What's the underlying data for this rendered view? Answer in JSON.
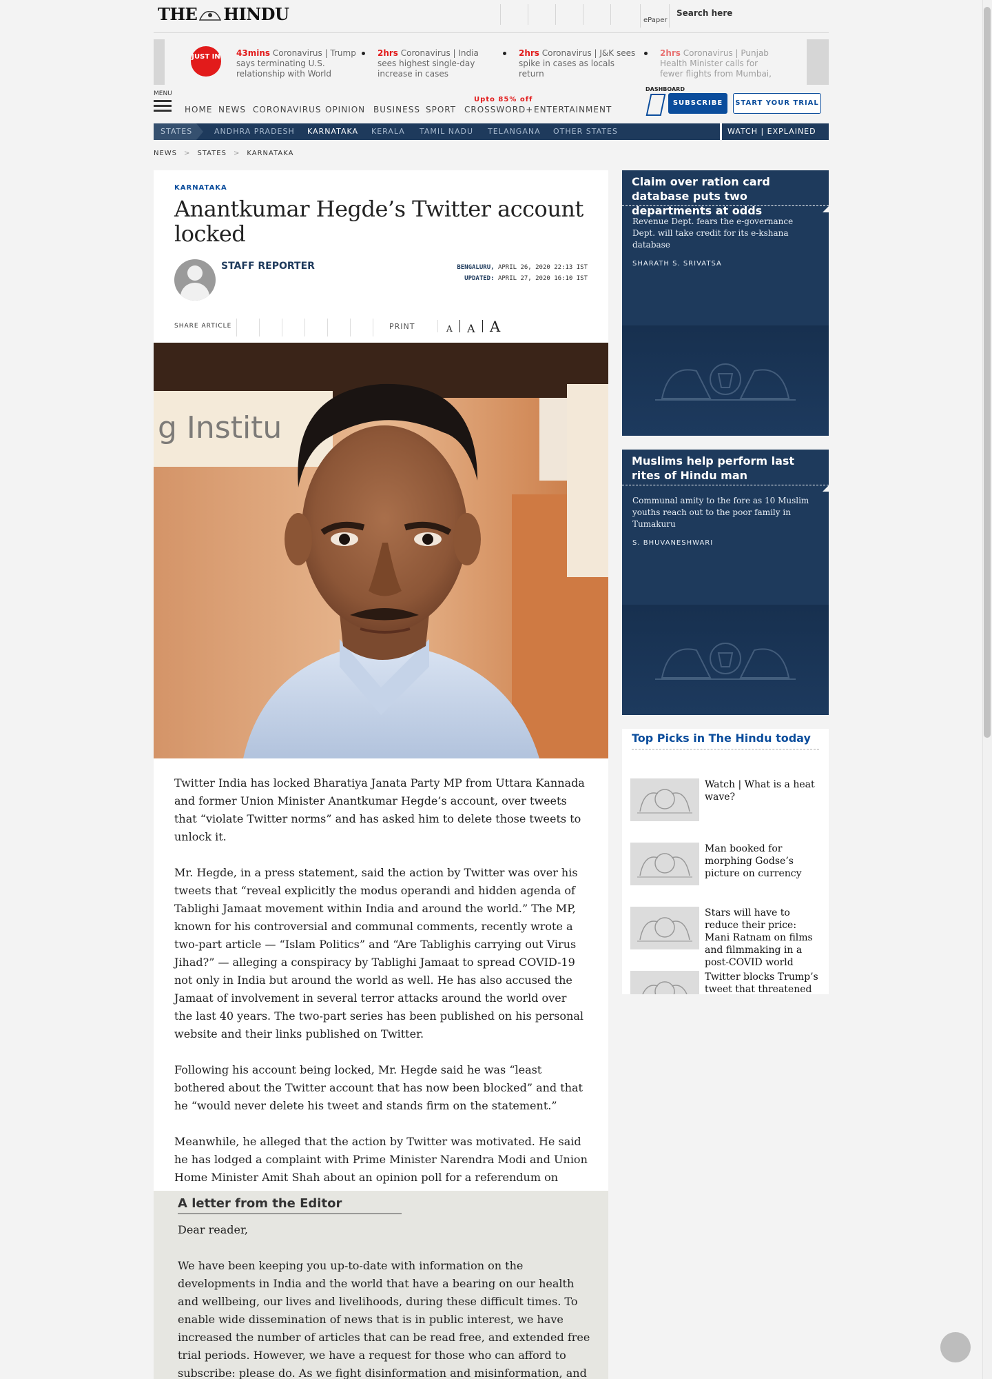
{
  "header": {
    "logo_left": "THE",
    "logo_right": "HINDU",
    "epaper_label": "ePaper",
    "search_label": "Search here"
  },
  "just_in": {
    "badge": "JUST IN",
    "items": [
      {
        "time": "43mins",
        "text": "Coronavirus | Trump says terminating U.S. relationship with World"
      },
      {
        "time": "2hrs",
        "text": "Coronavirus | India sees highest single-day increase in cases"
      },
      {
        "time": "2hrs",
        "text": "Coronavirus | J&K sees spike in cases as locals return"
      },
      {
        "time": "2hrs",
        "text": "Coronavirus | Punjab Health Minister calls for fewer flights from Mumbai,"
      }
    ]
  },
  "nav": {
    "menu_label": "MENU",
    "items": [
      "HOME",
      "NEWS",
      "CORONAVIRUS",
      "OPINION",
      "BUSINESS",
      "SPORT",
      "CROSSWORD+",
      "ENTERTAINMENT"
    ],
    "promo": "Upto 85% off",
    "dashboard": "DASHBOARD",
    "subscribe": "SUBSCRIBE",
    "trial": "START YOUR TRIAL"
  },
  "states_bar": {
    "tag": "STATES",
    "items": [
      "ANDHRA PRADESH",
      "KARNATAKA",
      "KERALA",
      "TAMIL NADU",
      "TELANGANA",
      "OTHER STATES"
    ],
    "active": "KARNATAKA",
    "watch": "WATCH | EXPLAINED"
  },
  "breadcrumb": [
    "NEWS",
    "STATES",
    "KARNATAKA"
  ],
  "article": {
    "kicker": "KARNATAKA",
    "headline": "Anantkumar Hegde’s Twitter account locked",
    "author": "STAFF REPORTER",
    "location": "BENGALURU,",
    "date": "APRIL 26, 2020 22:13 IST",
    "updated_label": "UPDATED:",
    "updated": "APRIL 27, 2020 16:10 IST",
    "share_label": "SHARE ARTICLE",
    "print_label": "PRINT",
    "font_small": "A",
    "font_medium": "A",
    "font_large": "A",
    "paragraphs": [
      "Twitter India has locked Bharatiya Janata Party MP from Uttara Kannada and former Union Minister Anantkumar Hegde’s account, over tweets that “violate Twitter norms” and has asked him to delete those tweets to unlock it.",
      "Mr. Hegde, in a press statement, said the action by Twitter was over his tweets that “reveal explicitly the modus operandi and hidden agenda of Tablighi Jamaat movement within India and around the world.” The MP, known for his controversial and communal comments, recently wrote a two-part article — “Islam Politics” and “Are Tablighis carrying out Virus Jihad?” — alleging a conspiracy by Tablighi Jamaat to spread COVID-19 not only in India but around the world as well. He has also accused the Jamaat of involvement in several terror attacks around the world over the last 40 years. The two-part series has been published on his personal website and their links published on Twitter.",
      "Following his account being locked, Mr. Hegde said he was “least bothered about the Twitter account that has now been blocked” and that he “would never delete his tweet and stands firm on the statement.”",
      "Meanwhile, he alleged that the action by Twitter was motivated. He said he has lodged a complaint with Prime Minister Narendra Modi and Union Home Minister Amit Shah about an opinion poll for a referendum on Khalistan, a separate Punjab, being promoted as an advertisement on Twitter."
    ],
    "photo_text": "g Institu"
  },
  "letter": {
    "title": "A letter from the Editor",
    "salutation": "Dear reader,",
    "body": "We have been keeping you up-to-date with information on the developments in India and the world that have a bearing on our health and wellbeing, our lives and livelihoods, during these difficult times. To enable wide dissemination of news that is in public interest, we have increased the number of articles that can be read free, and extended free trial periods. However, we have a request for those who can afford to subscribe: please do. As we fight disinformation and misinformation, and keep apace with the happenings, we need to commit greater resources to"
  },
  "sidebar": {
    "cards": [
      {
        "title": "Claim over ration card database puts two departments at odds",
        "summary": "Revenue Dept. fears the e-governance Dept. will take credit for its e-kshana database",
        "author": "SHARATH S. SRIVATSA"
      },
      {
        "title": "Muslims help perform last rites of Hindu man",
        "summary": "Communal amity to the fore as 10 Muslim youths reach out to the poor family in Tumakuru",
        "author": "S. BHUVANESHWARI"
      }
    ],
    "top_picks_title": "Top Picks in The Hindu today",
    "top_picks": [
      "Watch | What is a heat wave?",
      "Man booked for morphing Godse’s picture on currency",
      "Stars will have to reduce their price: Mani Ratnam on films and filmmaking in a post-COVID world",
      "Twitter blocks Trump’s tweet that threatened to"
    ]
  },
  "colors": {
    "brand_blue": "#0b4d9c",
    "navy": "#1e3a5c",
    "alert_red": "#e21b1b"
  }
}
